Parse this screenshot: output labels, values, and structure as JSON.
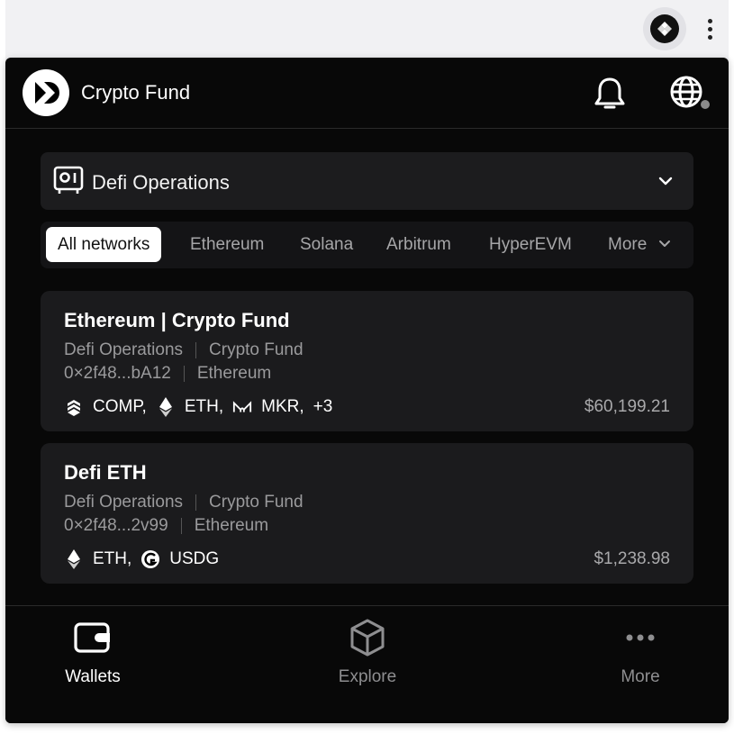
{
  "browser": {
    "extension_icon": "wallet-extension-icon",
    "menu_icon": "kebab-menu-icon"
  },
  "header": {
    "brand_name": "Crypto Fund",
    "logo_icon": "brand-logo-icon",
    "notifications_icon": "bell-icon",
    "language_icon": "globe-icon",
    "status_color": "#8a8a8a"
  },
  "account_selector": {
    "icon": "safe-vault-icon",
    "label": "Defi Operations"
  },
  "network_tabs": {
    "items": [
      "All networks",
      "Ethereum",
      "Solana",
      "Arbitrum",
      "HyperEVM"
    ],
    "more_label": "More",
    "selected": "All networks"
  },
  "wallets": [
    {
      "name": "Ethereum | Crypto Fund",
      "account": "Defi Operations",
      "entity": "Crypto Fund",
      "address": "0×2f48...bA12",
      "network": "Ethereum",
      "tokens": [
        {
          "symbol": "COMP,",
          "icon": "comp-token-icon"
        },
        {
          "symbol": "ETH,",
          "icon": "eth-token-icon"
        },
        {
          "symbol": "MKR,",
          "icon": "mkr-token-icon"
        }
      ],
      "extra_tokens": "+3",
      "balance": "$60,199.21"
    },
    {
      "name": "Defi ETH",
      "account": "Defi Operations",
      "entity": "Crypto Fund",
      "address": "0×2f48...2v99",
      "network": "Ethereum",
      "tokens": [
        {
          "symbol": "ETH,",
          "icon": "eth-token-icon"
        },
        {
          "symbol": "USDG",
          "icon": "usdg-token-icon"
        }
      ],
      "extra_tokens": "",
      "balance": "$1,238.98"
    }
  ],
  "bottom_nav": {
    "items": [
      {
        "label": "Wallets",
        "icon": "wallet-icon",
        "active": true
      },
      {
        "label": "Explore",
        "icon": "cube-icon",
        "active": false
      },
      {
        "label": "More",
        "icon": "more-dots-icon",
        "active": false
      }
    ]
  }
}
